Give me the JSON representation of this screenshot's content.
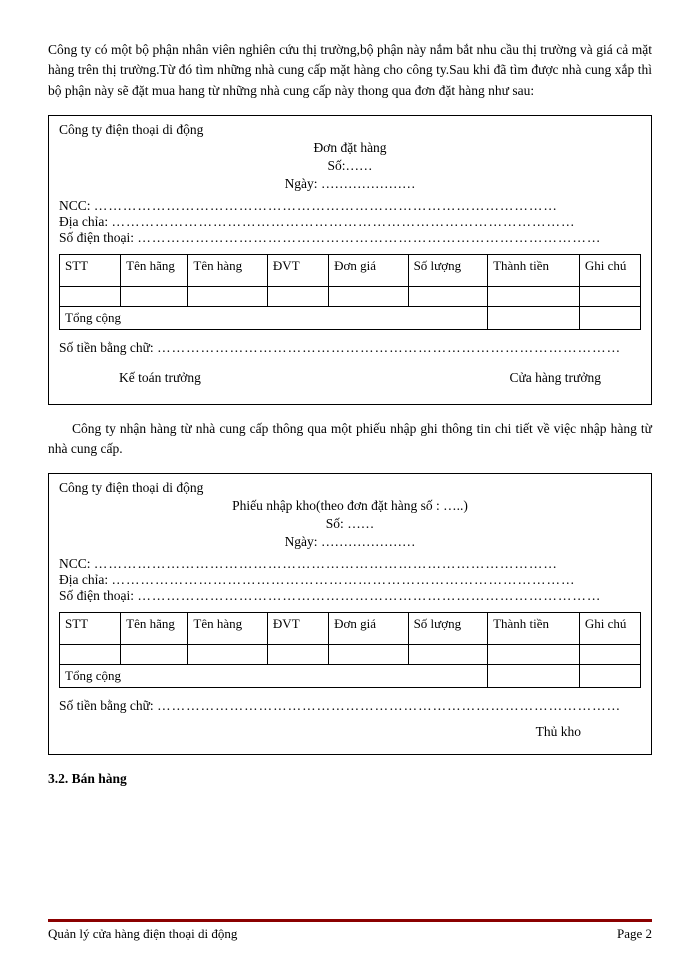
{
  "intro": "Công ty có một bộ phận nhân viên nghiên cứu thị trường,bộ phận này nắm bắt nhu cầu thị trường và giá cả mặt hàng trên thị trường.Từ đó tìm những nhà cung cấp mặt hàng cho công ty.Sau khi đã tìm được nhà cung xắp thì bộ phận này sẽ đặt mua hang từ những nhà cung cấp này thong qua đơn đặt hàng như sau:",
  "form1": {
    "company": "Công ty điện thoại di động",
    "title": "Đơn đặt hàng",
    "so_label": "Số:",
    "ngay_label": "Ngày:",
    "ncc_label": "NCC:",
    "diachi_label": "Địa chỉa:",
    "sdt_label": "Số điện thoại:",
    "cols": {
      "stt": "STT",
      "tenhang": "Tên hãng",
      "tenhang2": "Tên hàng",
      "dvt": "ĐVT",
      "dongia": "Đơn giá",
      "soluong": "Số lượng",
      "thanhtien": "Thành tiền",
      "ghichu": "Ghi chú"
    },
    "total": "Tổng cộng",
    "amount_words": "Số tiền bằng chữ:",
    "sign_left": "Kế toán trưởng",
    "sign_right": "Cửa hàng trưởng"
  },
  "mid_text": "Công ty nhận hàng từ nhà cung cấp thông qua một phiếu nhập ghi thông tin chi tiết về việc nhập hàng từ nhà cung cấp.",
  "form2": {
    "company": "Công ty điện thoại di động",
    "title": "Phiếu nhập kho(theo đơn đặt hàng số : …..)",
    "so_label": "Số:",
    "ngay_label": "Ngày:",
    "ncc_label": "NCC:",
    "diachi_label": "Địa chỉa:",
    "sdt_label": "Số điện thoại:",
    "cols": {
      "stt": "STT",
      "tenhang": "Tên hãng",
      "tenhang2": "Tên hàng",
      "dvt": "ĐVT",
      "dongia": "Đơn giá",
      "soluong": "Số lượng",
      "thanhtien": "Thành tiền",
      "ghichu": "Ghi chú"
    },
    "total": "Tổng cộng",
    "amount_words": "Số tiền bằng chữ:",
    "sign": "Thủ kho"
  },
  "section_heading": "3.2. Bán hàng",
  "footer": {
    "left": "Quản lý cửa hàng điện thoại di động",
    "right": "Page 2"
  },
  "dots_long": "……………………………………………………………………………………",
  "dots_short": "…………………",
  "dots_tiny": "……"
}
